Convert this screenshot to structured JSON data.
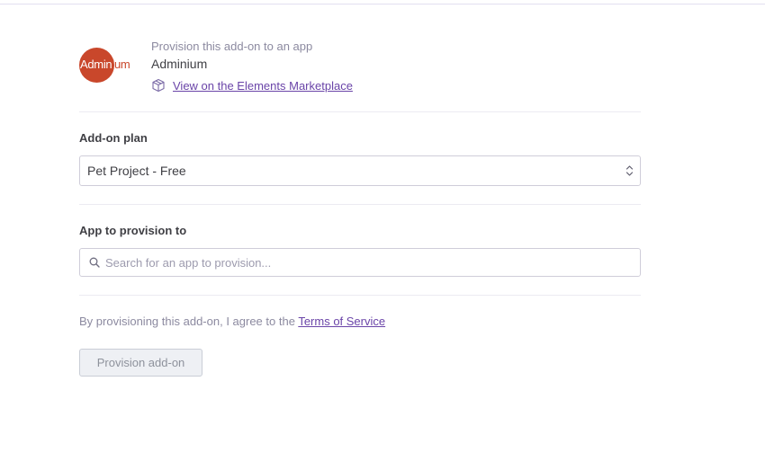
{
  "header": {
    "subtitle": "Provision this add-on to an app",
    "addon_name": "Adminium",
    "logo_text_main": "Admin",
    "logo_text_tail": "ium",
    "marketplace_link": "View on the Elements Marketplace",
    "logo_color": "#c9472b"
  },
  "plan": {
    "label": "Add-on plan",
    "selected": "Pet Project - Free"
  },
  "app": {
    "label": "App to provision to",
    "placeholder": "Search for an app to provision...",
    "value": ""
  },
  "terms": {
    "prefix": "By provisioning this add-on, I agree to the ",
    "link": "Terms of Service"
  },
  "actions": {
    "provision_label": "Provision add-on"
  },
  "colors": {
    "link": "#6a44a8",
    "disabled_button_bg": "#eef0f4"
  }
}
